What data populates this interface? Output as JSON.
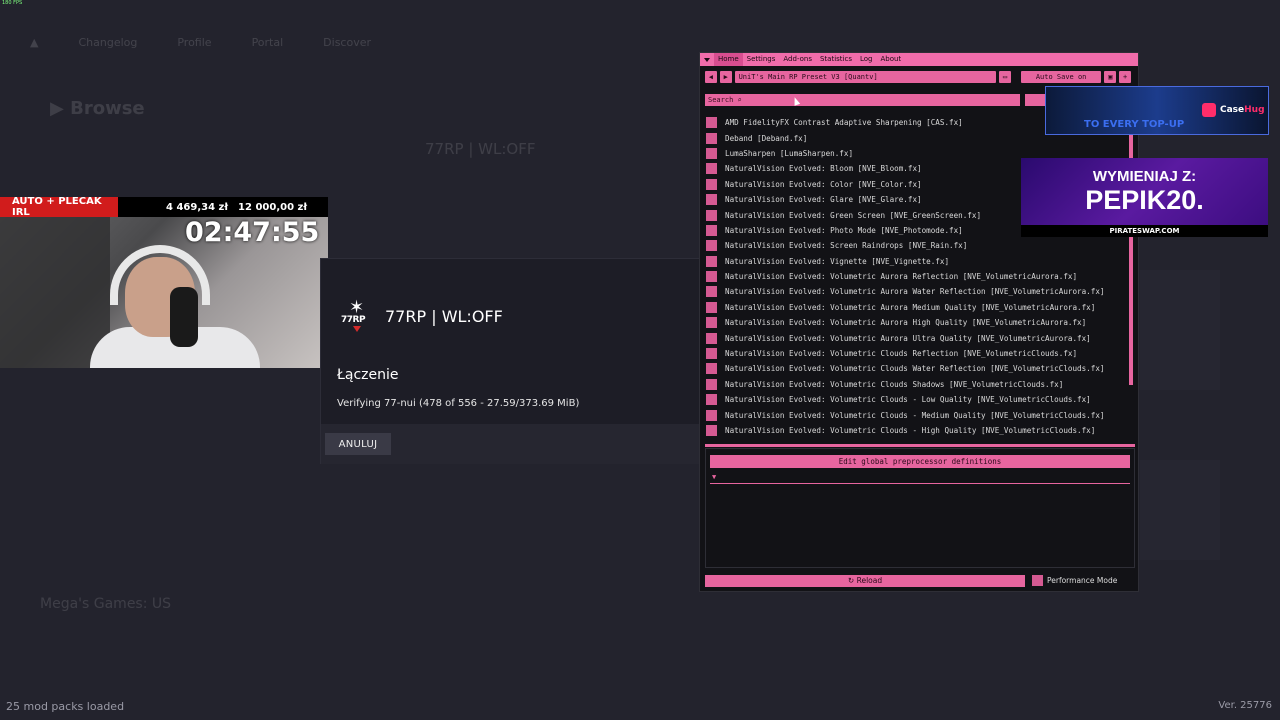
{
  "fps": "180 FPS",
  "stream": {
    "goal_label": "AUTO + PLECAK IRL",
    "current_amount": "4 469,34 zł",
    "target_amount": "12 000,00 zł",
    "timer": "02:47:55"
  },
  "background": {
    "nav": [
      "Changelog",
      "Profile",
      "Portal",
      "Discover"
    ],
    "title": "Browse",
    "server": "77RP | WL:OFF",
    "favorite": "Mega's Games: US"
  },
  "dialog": {
    "logo_text": "77RP",
    "server_name": "77RP | WL:OFF",
    "title": "Łączenie",
    "status": "Verifying 77-nui (478 of 556 - 27.59/373.69 MiB)",
    "cancel_label": "ANULUJ"
  },
  "reshade": {
    "menu": [
      "Home",
      "Settings",
      "Add-ons",
      "Statistics",
      "Log",
      "About"
    ],
    "active_menu": "Home",
    "preset": "UniT's Main RP Preset V3 [Quantv]",
    "auto_save": "Auto Save on",
    "search_placeholder": "Search",
    "effects": [
      "AMD FidelityFX Contrast Adaptive Sharpening [CAS.fx]",
      "Deband [Deband.fx]",
      "LumaSharpen [LumaSharpen.fx]",
      "NaturalVision Evolved: Bloom [NVE_Bloom.fx]",
      "NaturalVision Evolved: Color [NVE_Color.fx]",
      "NaturalVision Evolved: Glare [NVE_Glare.fx]",
      "NaturalVision Evolved: Green Screen [NVE_GreenScreen.fx]",
      "NaturalVision Evolved: Photo Mode [NVE_Photomode.fx]",
      "NaturalVision Evolved: Screen Raindrops [NVE_Rain.fx]",
      "NaturalVision Evolved: Vignette [NVE_Vignette.fx]",
      "NaturalVision Evolved: Volumetric Aurora Reflection [NVE_VolumetricAurora.fx]",
      "NaturalVision Evolved: Volumetric Aurora Water Reflection [NVE_VolumetricAurora.fx]",
      "NaturalVision Evolved: Volumetric Aurora Medium Quality [NVE_VolumetricAurora.fx]",
      "NaturalVision Evolved: Volumetric Aurora High Quality [NVE_VolumetricAurora.fx]",
      "NaturalVision Evolved: Volumetric Aurora Ultra Quality [NVE_VolumetricAurora.fx]",
      "NaturalVision Evolved: Volumetric Clouds Reflection [NVE_VolumetricClouds.fx]",
      "NaturalVision Evolved: Volumetric Clouds Water Reflection [NVE_VolumetricClouds.fx]",
      "NaturalVision Evolved: Volumetric Clouds Shadows [NVE_VolumetricClouds.fx]",
      "NaturalVision Evolved: Volumetric Clouds - Low Quality [NVE_VolumetricClouds.fx]",
      "NaturalVision Evolved: Volumetric Clouds - Medium Quality [NVE_VolumetricClouds.fx]",
      "NaturalVision Evolved: Volumetric Clouds - High Quality [NVE_VolumetricClouds.fx]"
    ],
    "preprocessor_label": "Edit global preprocessor definitions",
    "reload_label": "↻ Reload",
    "performance_mode": "Performance Mode",
    "accent_color": "#e7659f"
  },
  "ads": {
    "casehug_slogan": "TO EVERY TOP-UP",
    "casehug_brand_a": "Case",
    "casehug_brand_b": "Hug",
    "pirate_line1": "WYMIENIAJ Z:",
    "pirate_line2": "PEPIK20.",
    "pirate_site": "PIRATESWAP.COM"
  },
  "footer": {
    "mod_packs": "25 mod packs loaded",
    "version": "Ver. 25776"
  }
}
